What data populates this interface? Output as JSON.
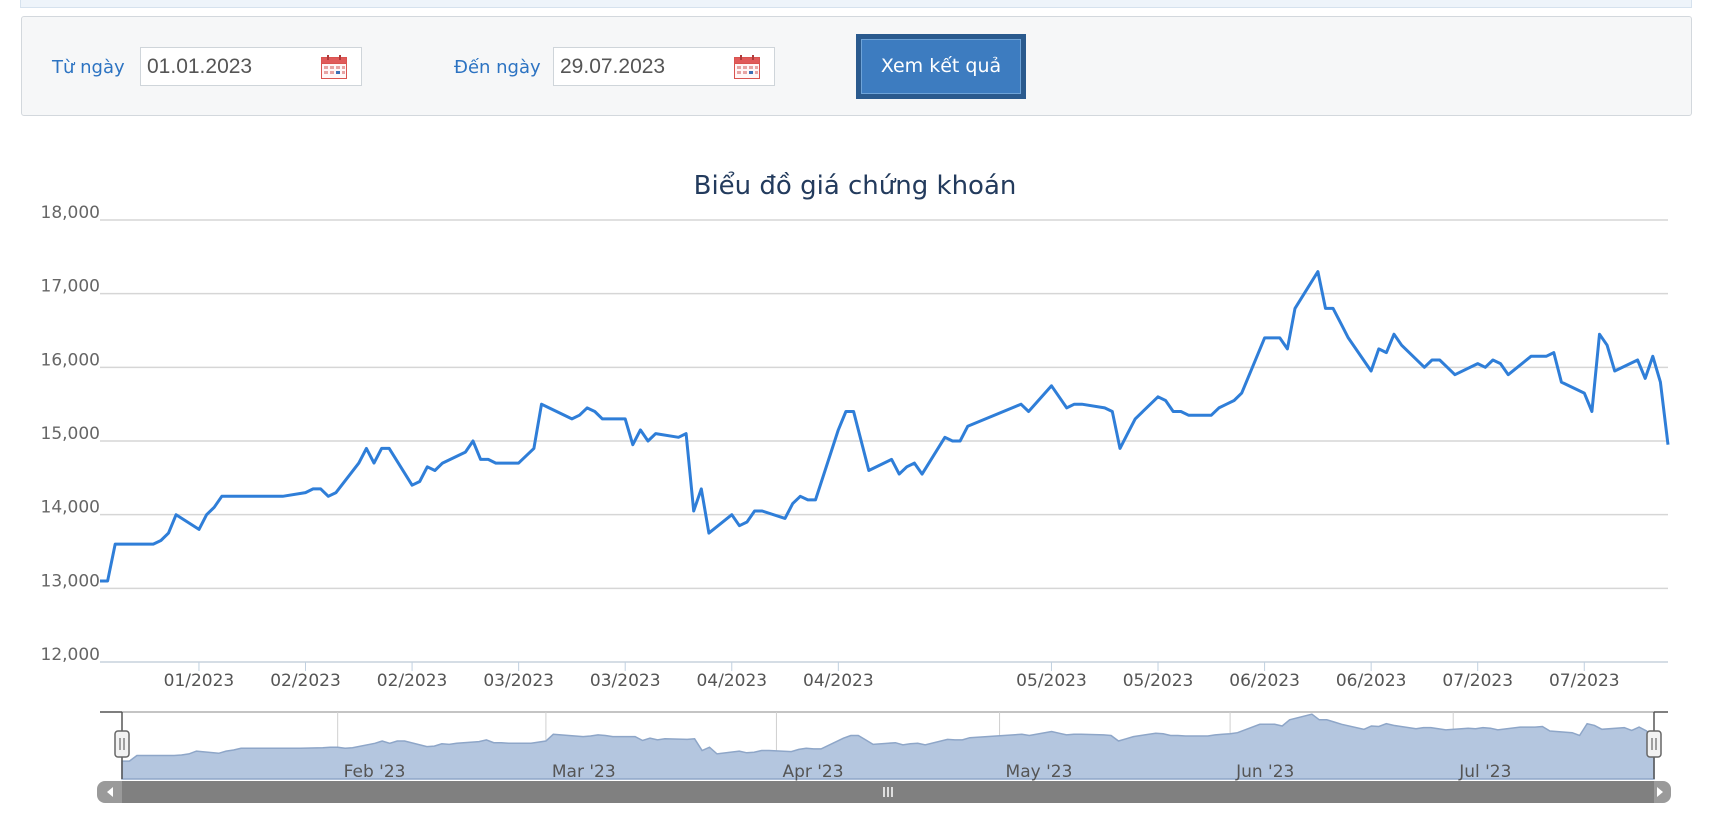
{
  "filter": {
    "from_label": "Từ ngày",
    "from_value": "01.01.2023",
    "to_label": "Đến ngày",
    "to_value": "29.07.2023",
    "submit_label": "Xem kết quả"
  },
  "colors": {
    "line": "#2f7ed8",
    "navigator_fill": "#b4c6df",
    "navigator_line": "#8ea6c8",
    "scrollbar": "#808080",
    "label_blue": "#2c73c2"
  },
  "icons": {
    "calendar": "calendar-icon",
    "scroll_left": "arrow-left-icon",
    "scroll_right": "arrow-right-icon",
    "scroll_grip": "grip-icon",
    "navigator_handle": "handle-icon"
  },
  "chart_data": {
    "type": "line",
    "title": "Biểu đồ giá chứng khoán",
    "ylim": [
      12000,
      18000
    ],
    "yticks": [
      "12,000",
      "13,000",
      "14,000",
      "15,000",
      "16,000",
      "17,000",
      "18,000"
    ],
    "xticks": [
      {
        "label": "01/2023",
        "date": "2023-01-16"
      },
      {
        "label": "02/2023",
        "date": "2023-01-30"
      },
      {
        "label": "02/2023",
        "date": "2023-02-13"
      },
      {
        "label": "03/2023",
        "date": "2023-02-27"
      },
      {
        "label": "03/2023",
        "date": "2023-03-13"
      },
      {
        "label": "04/2023",
        "date": "2023-03-27"
      },
      {
        "label": "04/2023",
        "date": "2023-04-10"
      },
      {
        "label": "05/2023",
        "date": "2023-05-08"
      },
      {
        "label": "05/2023",
        "date": "2023-05-22"
      },
      {
        "label": "06/2023",
        "date": "2023-06-05"
      },
      {
        "label": "06/2023",
        "date": "2023-06-19"
      },
      {
        "label": "07/2023",
        "date": "2023-07-03"
      },
      {
        "label": "07/2023",
        "date": "2023-07-17"
      }
    ],
    "x_range": [
      "2023-01-03",
      "2023-07-28"
    ],
    "grid": true,
    "legend": "none",
    "series": [
      {
        "points": [
          [
            "2023-01-03",
            13100
          ],
          [
            "2023-01-04",
            13100
          ],
          [
            "2023-01-05",
            13600
          ],
          [
            "2023-01-06",
            13600
          ],
          [
            "2023-01-09",
            13600
          ],
          [
            "2023-01-10",
            13600
          ],
          [
            "2023-01-11",
            13650
          ],
          [
            "2023-01-12",
            13750
          ],
          [
            "2023-01-13",
            14000
          ],
          [
            "2023-01-16",
            13800
          ],
          [
            "2023-01-17",
            14000
          ],
          [
            "2023-01-18",
            14100
          ],
          [
            "2023-01-19",
            14250
          ],
          [
            "2023-01-27",
            14250
          ],
          [
            "2023-01-30",
            14300
          ],
          [
            "2023-01-31",
            14350
          ],
          [
            "2023-02-01",
            14350
          ],
          [
            "2023-02-02",
            14250
          ],
          [
            "2023-02-03",
            14300
          ],
          [
            "2023-02-06",
            14700
          ],
          [
            "2023-02-07",
            14900
          ],
          [
            "2023-02-08",
            14700
          ],
          [
            "2023-02-09",
            14900
          ],
          [
            "2023-02-10",
            14900
          ],
          [
            "2023-02-13",
            14400
          ],
          [
            "2023-02-14",
            14450
          ],
          [
            "2023-02-15",
            14650
          ],
          [
            "2023-02-16",
            14600
          ],
          [
            "2023-02-17",
            14700
          ],
          [
            "2023-02-20",
            14850
          ],
          [
            "2023-02-21",
            15000
          ],
          [
            "2023-02-22",
            14750
          ],
          [
            "2023-02-23",
            14750
          ],
          [
            "2023-02-24",
            14700
          ],
          [
            "2023-02-27",
            14700
          ],
          [
            "2023-02-28",
            14800
          ],
          [
            "2023-03-01",
            14900
          ],
          [
            "2023-03-02",
            15500
          ],
          [
            "2023-03-03",
            15450
          ],
          [
            "2023-03-06",
            15300
          ],
          [
            "2023-03-07",
            15350
          ],
          [
            "2023-03-08",
            15450
          ],
          [
            "2023-03-09",
            15400
          ],
          [
            "2023-03-10",
            15300
          ],
          [
            "2023-03-13",
            15300
          ],
          [
            "2023-03-14",
            14950
          ],
          [
            "2023-03-15",
            15150
          ],
          [
            "2023-03-16",
            15000
          ],
          [
            "2023-03-17",
            15100
          ],
          [
            "2023-03-20",
            15050
          ],
          [
            "2023-03-21",
            15100
          ],
          [
            "2023-03-22",
            14050
          ],
          [
            "2023-03-23",
            14350
          ],
          [
            "2023-03-24",
            13750
          ],
          [
            "2023-03-27",
            14000
          ],
          [
            "2023-03-28",
            13850
          ],
          [
            "2023-03-29",
            13900
          ],
          [
            "2023-03-30",
            14050
          ],
          [
            "2023-03-31",
            14050
          ],
          [
            "2023-04-03",
            13950
          ],
          [
            "2023-04-04",
            14150
          ],
          [
            "2023-04-05",
            14250
          ],
          [
            "2023-04-06",
            14200
          ],
          [
            "2023-04-07",
            14200
          ],
          [
            "2023-04-10",
            15150
          ],
          [
            "2023-04-11",
            15400
          ],
          [
            "2023-04-12",
            15400
          ],
          [
            "2023-04-13",
            15000
          ],
          [
            "2023-04-14",
            14600
          ],
          [
            "2023-04-17",
            14750
          ],
          [
            "2023-04-18",
            14550
          ],
          [
            "2023-04-19",
            14650
          ],
          [
            "2023-04-20",
            14700
          ],
          [
            "2023-04-21",
            14550
          ],
          [
            "2023-04-24",
            15050
          ],
          [
            "2023-04-25",
            15000
          ],
          [
            "2023-04-26",
            15000
          ],
          [
            "2023-04-27",
            15200
          ],
          [
            "2023-05-04",
            15500
          ],
          [
            "2023-05-05",
            15400
          ],
          [
            "2023-05-08",
            15750
          ],
          [
            "2023-05-09",
            15600
          ],
          [
            "2023-05-10",
            15450
          ],
          [
            "2023-05-11",
            15500
          ],
          [
            "2023-05-12",
            15500
          ],
          [
            "2023-05-15",
            15450
          ],
          [
            "2023-05-16",
            15400
          ],
          [
            "2023-05-17",
            14900
          ],
          [
            "2023-05-18",
            15100
          ],
          [
            "2023-05-19",
            15300
          ],
          [
            "2023-05-22",
            15600
          ],
          [
            "2023-05-23",
            15550
          ],
          [
            "2023-05-24",
            15400
          ],
          [
            "2023-05-25",
            15400
          ],
          [
            "2023-05-26",
            15350
          ],
          [
            "2023-05-29",
            15350
          ],
          [
            "2023-05-30",
            15450
          ],
          [
            "2023-05-31",
            15500
          ],
          [
            "2023-06-01",
            15550
          ],
          [
            "2023-06-02",
            15650
          ],
          [
            "2023-06-05",
            16400
          ],
          [
            "2023-06-06",
            16400
          ],
          [
            "2023-06-07",
            16400
          ],
          [
            "2023-06-08",
            16250
          ],
          [
            "2023-06-09",
            16800
          ],
          [
            "2023-06-12",
            17300
          ],
          [
            "2023-06-13",
            16800
          ],
          [
            "2023-06-14",
            16800
          ],
          [
            "2023-06-15",
            16600
          ],
          [
            "2023-06-16",
            16400
          ],
          [
            "2023-06-19",
            15950
          ],
          [
            "2023-06-20",
            16250
          ],
          [
            "2023-06-21",
            16200
          ],
          [
            "2023-06-22",
            16450
          ],
          [
            "2023-06-23",
            16300
          ],
          [
            "2023-06-26",
            16000
          ],
          [
            "2023-06-27",
            16100
          ],
          [
            "2023-06-28",
            16100
          ],
          [
            "2023-06-29",
            16000
          ],
          [
            "2023-06-30",
            15900
          ],
          [
            "2023-07-03",
            16050
          ],
          [
            "2023-07-04",
            16000
          ],
          [
            "2023-07-05",
            16100
          ],
          [
            "2023-07-06",
            16050
          ],
          [
            "2023-07-07",
            15900
          ],
          [
            "2023-07-10",
            16150
          ],
          [
            "2023-07-11",
            16150
          ],
          [
            "2023-07-12",
            16150
          ],
          [
            "2023-07-13",
            16200
          ],
          [
            "2023-07-14",
            15800
          ],
          [
            "2023-07-17",
            15650
          ],
          [
            "2023-07-18",
            15400
          ],
          [
            "2023-07-19",
            16450
          ],
          [
            "2023-07-20",
            16300
          ],
          [
            "2023-07-21",
            15950
          ],
          [
            "2023-07-24",
            16100
          ],
          [
            "2023-07-25",
            15850
          ],
          [
            "2023-07-26",
            16150
          ],
          [
            "2023-07-27",
            15800
          ],
          [
            "2023-07-28",
            14950
          ]
        ]
      }
    ],
    "navigator": {
      "labels": [
        {
          "label": "Feb '23",
          "date": "2023-02-01"
        },
        {
          "label": "Mar '23",
          "date": "2023-03-01"
        },
        {
          "label": "Apr '23",
          "date": "2023-04-01"
        },
        {
          "label": "May '23",
          "date": "2023-05-01"
        },
        {
          "label": "Jun '23",
          "date": "2023-06-01"
        },
        {
          "label": "Jul '23",
          "date": "2023-07-01"
        }
      ]
    }
  }
}
